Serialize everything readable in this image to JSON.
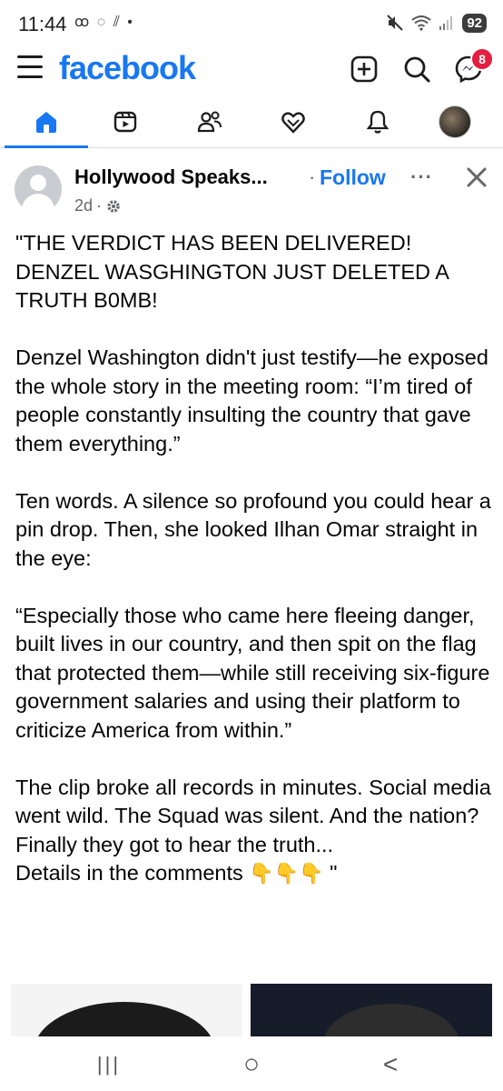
{
  "status_bar": {
    "time": "11:44",
    "left_icons": "ꝏ ◌ ⫽ •",
    "battery": "92"
  },
  "header": {
    "brand": "facebook",
    "messenger_badge": "8",
    "brand_color": "#1877f2"
  },
  "tabs": [
    {
      "icon": "home-icon",
      "active": true
    },
    {
      "icon": "video-icon",
      "active": false
    },
    {
      "icon": "friends-icon",
      "active": false
    },
    {
      "icon": "dating-heart-icon",
      "active": false
    },
    {
      "icon": "bell-icon",
      "active": false
    },
    {
      "icon": "profile-avatar",
      "active": false
    }
  ],
  "post": {
    "page_name": "Hollywood Speaks...",
    "separator": "·",
    "follow_label": "Follow",
    "more_label": "···",
    "time": "2d",
    "meta_sep": "·",
    "paragraphs": [
      "\"THE VERDICT HAS BEEN DELIVERED! DENZEL WASGHINGTON JUST DELETED A TRUTH B0MB!",
      "Denzel Washington didn't just testify—he exposed the whole story in the meeting room: “I’m tired of people constantly insulting the country that gave them everything.”",
      "Ten words. A silence so profound you could hear a pin drop. Then, she looked Ilhan Omar straight in the eye:",
      "“Especially those who came here fleeing danger, built lives in our country, and then spit on the flag that protected them—while still receiving six-figure government salaries and using their platform to criticize America from within.”",
      "The clip broke all records in minutes. Social media went wild. The Squad was silent. And the nation? Finally they got to hear the truth..."
    ],
    "last_line": "Details in the comments",
    "closing_quote": "\""
  },
  "nav_bar": {
    "recent_label": "|||",
    "home_label": "○",
    "back_label": "<"
  }
}
